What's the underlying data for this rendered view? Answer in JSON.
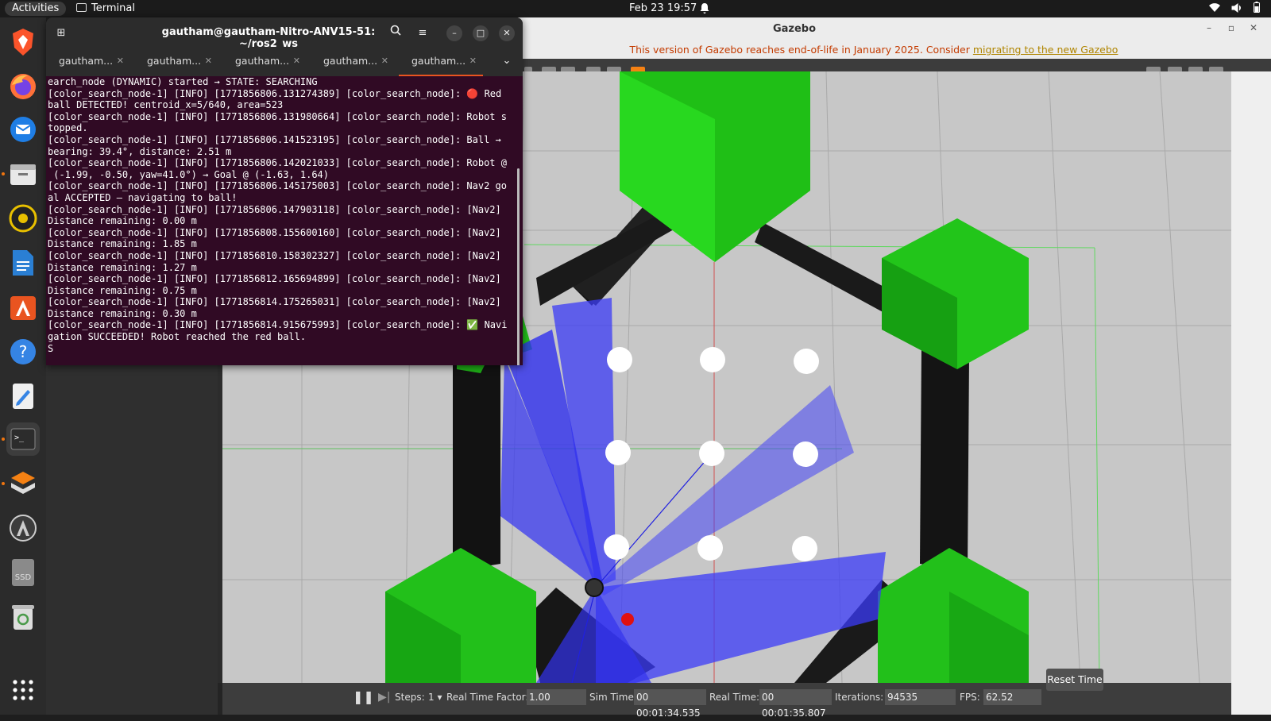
{
  "topbar": {
    "activities": "Activities",
    "app_name": "Terminal",
    "clock": "Feb 23  19:57"
  },
  "dock": {
    "items": [
      "brave-icon",
      "firefox-icon",
      "thunderbird-icon",
      "files-icon",
      "rhythmbox-icon",
      "writer-icon",
      "app-center-icon",
      "help-icon",
      "text-editor-icon",
      "terminal-icon",
      "gazebo-icon",
      "software-updater-icon",
      "ssd-drive-icon",
      "trash-icon",
      "show-apps-icon"
    ],
    "ssd_label": "SSD"
  },
  "terminal": {
    "title": "gautham@gautham-Nitro-ANV15-51: ~/ros2_ws",
    "tabs": [
      {
        "label": "gautham..."
      },
      {
        "label": "gautham..."
      },
      {
        "label": "gautham..."
      },
      {
        "label": "gautham..."
      },
      {
        "label": "gautham..."
      }
    ],
    "output": "earch_node (DYNAMIC) started → STATE: SEARCHING\n[color_search_node-1] [INFO] [1771856806.131274389] [color_search_node]: 🔴 Red\nball DETECTED! centroid_x=5/640, area=523\n[color_search_node-1] [INFO] [1771856806.131980664] [color_search_node]: Robot s\ntopped.\n[color_search_node-1] [INFO] [1771856806.141523195] [color_search_node]: Ball →\nbearing: 39.4°, distance: 2.51 m\n[color_search_node-1] [INFO] [1771856806.142021033] [color_search_node]: Robot @\n (-1.99, -0.50, yaw=41.0°) → Goal @ (-1.63, 1.64)\n[color_search_node-1] [INFO] [1771856806.145175003] [color_search_node]: Nav2 go\nal ACCEPTED — navigating to ball!\n[color_search_node-1] [INFO] [1771856806.147903118] [color_search_node]: [Nav2]\nDistance remaining: 0.00 m\n[color_search_node-1] [INFO] [1771856808.155600160] [color_search_node]: [Nav2]\nDistance remaining: 1.85 m\n[color_search_node-1] [INFO] [1771856810.158302327] [color_search_node]: [Nav2]\nDistance remaining: 1.27 m\n[color_search_node-1] [INFO] [1771856812.165694899] [color_search_node]: [Nav2]\nDistance remaining: 0.75 m\n[color_search_node-1] [INFO] [1771856814.175265031] [color_search_node]: [Nav2]\nDistance remaining: 0.30 m\n[color_search_node-1] [INFO] [1771856814.915675993] [color_search_node]: ✅ Navi\ngation SUCCEEDED! Robot reached the red ball.\nS"
  },
  "gazebo": {
    "title": "Gazebo",
    "banner_text": "This version of Gazebo reaches end-of-life in January 2025. Consider ",
    "banner_link": "migrating to the new Gazebo",
    "status": {
      "steps_label": "Steps:",
      "steps_value": "1",
      "rtf_label": "Real Time Factor:",
      "rtf_value": "1.00",
      "sim_label": "Sim Time:",
      "sim_value": "00 00:01:34.535",
      "real_label": "Real Time:",
      "real_value": "00 00:01:35.807",
      "iter_label": "Iterations:",
      "iter_value": "94535",
      "fps_label": "FPS:",
      "fps_value": "62.52",
      "reset_label": "Reset Time"
    }
  },
  "colors": {
    "accent": "#e95420",
    "terminal_bg": "#300a24",
    "hex_green": "#22c01a",
    "laser_blue": "#2a2aff",
    "ball_red": "#e01010"
  }
}
